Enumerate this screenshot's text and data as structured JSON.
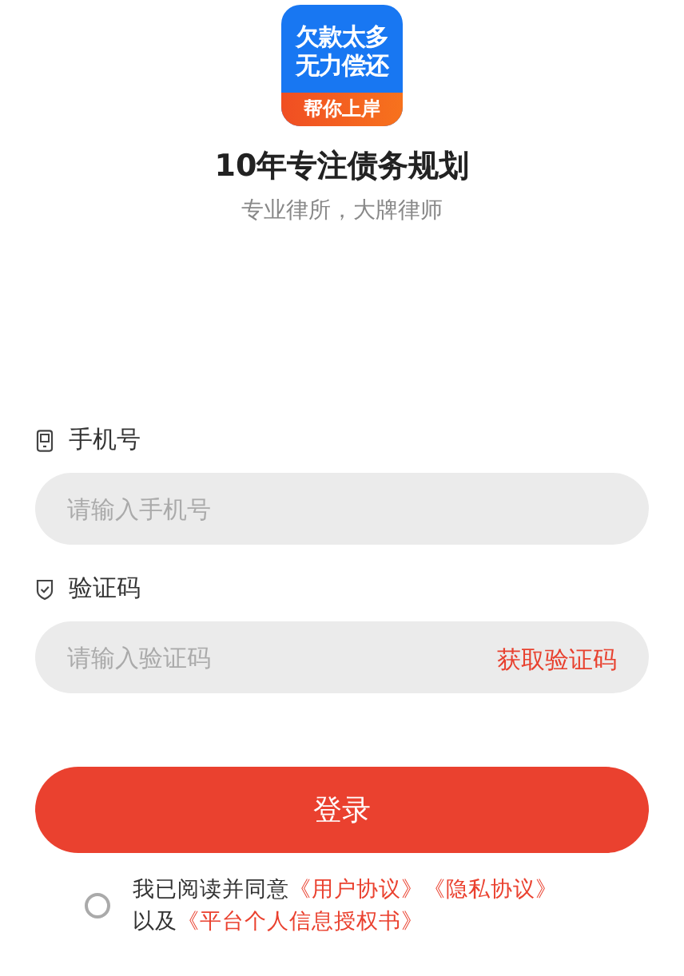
{
  "logo": {
    "lines": [
      "欠款太多",
      "无力偿还"
    ],
    "banner": "帮你上岸"
  },
  "title": "10年专注债务规划",
  "subtitle": "专业律所，大牌律师",
  "fields": [
    {
      "kind": "phone",
      "label": "手机号",
      "placeholder": "请输入手机号"
    },
    {
      "kind": "code",
      "label": "验证码",
      "placeholder": "请输入验证码",
      "action": "获取验证码"
    }
  ],
  "login_button": "登录",
  "agreement": {
    "checked": false,
    "parts": [
      {
        "kind": "text",
        "text": "我已阅读并同意"
      },
      {
        "kind": "link",
        "text": "《用户协议》"
      },
      {
        "kind": "link",
        "text": "《隐私协议》"
      },
      {
        "kind": "text",
        "text": "以及"
      },
      {
        "kind": "link",
        "text": "《平台个人信息授权书》"
      }
    ]
  }
}
